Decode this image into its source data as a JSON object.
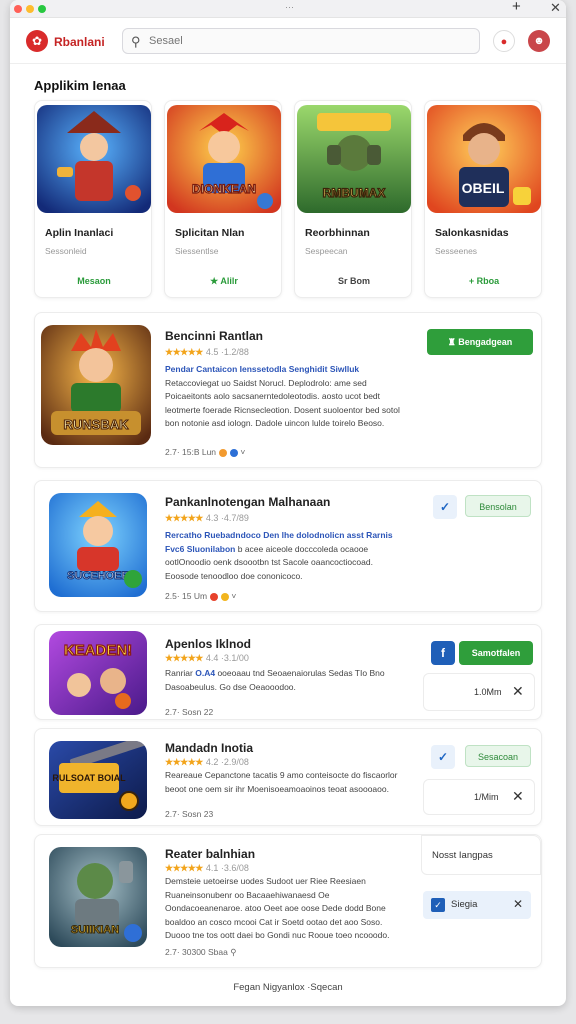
{
  "window": {
    "title_glyph": "···",
    "new_tab": "+",
    "close": "✕",
    "dot_colors": [
      "#ff5f57",
      "#febc2e",
      "#28c840"
    ]
  },
  "header": {
    "brand": "Rbanlani",
    "search_placeholder": "Sesael"
  },
  "section": {
    "title": "Applikim Ienaa"
  },
  "cards": [
    {
      "name": "Aplin Inanlaci",
      "sub": "Sessonleid",
      "tag": "Mesaon"
    },
    {
      "name": "Splicitan Nlan",
      "sub": "Siessentlse",
      "tag": "★ Alilr"
    },
    {
      "name": "Reorbhinnan",
      "sub": "Sespeecan",
      "tag": "Sr Bom"
    },
    {
      "name": "Salonkasnidas",
      "sub": "Sesseenes",
      "tag": "+ Rboa"
    }
  ],
  "cards_art_text": [
    "",
    "DIONKEAN",
    "RMBUMAX",
    "OBEIL"
  ],
  "rows": [
    {
      "title": "Bencinni Rantlan",
      "stars": "★★★★★",
      "rating_text": "4.5 ·1.2/88",
      "desc": [
        {
          "t": "Pendar Cantaicon Ienssetodla Senghidit Siwlluk ",
          "hl": true
        },
        {
          "t": "Retaccoviegat uo Saidst Norucl. Deplodrolo: ame sed Poicaeitonts aolo sacsanerntedoleotodis. aosto ucot bedt leotmerte foerade Ricnsecleotion. Dosent suoloentor bed sotol bon notonie asd iologn. Dadole uincon lulde toirelo Beoso.",
          "hl": false
        }
      ],
      "meta": "2.7· 15:B Lun",
      "button": "Bengadgean",
      "art_text": "RUNSBAK"
    },
    {
      "title": "Pankanlnotengan Malhanaan",
      "stars": "★★★★★",
      "rating_text": "4.3 ·4.7/89",
      "desc": [
        {
          "t": "Rercatho Ruebadndoco Den lhe dolodnolicn asst Rarnis Fvc6 Sluonilabon ",
          "hl": true
        },
        {
          "t": "b acee aiceole docccoleda ocaooe ootlOnoodio oenk dsoootbn tst Sacole oaancoctiocoad. Eoosode tenoodloo doe cononicoco.",
          "hl": false
        }
      ],
      "meta": "2.5· 15 Um",
      "button": "Bensolan",
      "art_text": "SUCEHOEE"
    },
    {
      "title": "Apenlos Iklnod",
      "stars": "★★★★★",
      "rating_text": "4.4 ·3.1/00",
      "desc": [
        {
          "t": "Ranriar ",
          "hl": false
        },
        {
          "t": "O.A4 ",
          "hl": true
        },
        {
          "t": "ooeoaau tnd Seoaenaiorulas Sedas TIo Bno Dasoabeulus. Go dse Oeaooodoo.",
          "hl": false
        }
      ],
      "meta": "2.7· Sosn 22",
      "button": "Samotfalen",
      "size": "1.0Mm",
      "art_text": "KEADEN!"
    },
    {
      "title": "Mandadn Inotia",
      "stars": "★★★★★",
      "rating_text": "4.2 ·2.9/08",
      "desc": [
        {
          "t": "Reareaue Cepanctone tacatis 9 amo conteisocte do fiscaorlor beoot one oem sir ihr Moenisoeamoaoinos teoat asoooaoo.",
          "hl": false
        }
      ],
      "meta": "2.7· Sosn 23",
      "button": "Sesacoan",
      "size": "1/Mim",
      "art_text": "RULSOAT BOIAL"
    },
    {
      "title": "Reater balnhian",
      "stars": "★★★★★",
      "rating_text": "4.1 ·3.6/08",
      "desc": [
        {
          "t": "Demsteie uetoeirse uodes Sudoot uer Riee Reesiaen Ruaneinsonubenr oo Bacaaehiwanaesd Oe Oondacoeanenaroe. atoo Oeet aoe oose Dede dodd Bone boaldoo an cosco mcooi Cat ir Soetd ootao det aoo Soso. Duooo tne tos oott daei bo Gondi nuc Rooue toeo ncooodo.",
          "hl": false
        }
      ],
      "meta": "2.7· 30300 Sbaa ⚲",
      "side_title": "Nosst Iangpas",
      "side_item": "Siegia",
      "art_text": "SUIIKIAN"
    }
  ],
  "footer": "Fegan Nigyanlox  ·Sqecan",
  "colors": {
    "accent_green": "#2f9e3b",
    "brand_red": "#d92b2b",
    "star": "#f2a41b",
    "link_blue": "#2c55b8"
  }
}
